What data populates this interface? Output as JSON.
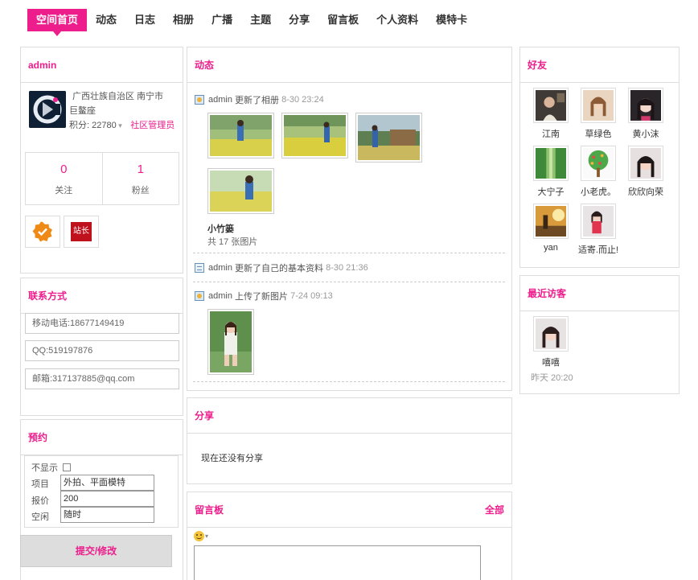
{
  "nav": {
    "tabs": [
      "空间首页",
      "动态",
      "日志",
      "相册",
      "广播",
      "主题",
      "分享",
      "留言板",
      "个人资料",
      "模特卡"
    ]
  },
  "profile": {
    "title": "admin",
    "location": "广西壮族自治区 南宁市",
    "level": "巨鳌座",
    "credit_label": "积分: 22780",
    "role": "社区管理员",
    "follow_count": "0",
    "follow_label": "关注",
    "fans_count": "1",
    "fans_label": "粉丝",
    "badge2_text": "站长"
  },
  "contact": {
    "title": "联系方式",
    "phone": "移动电话:18677149419",
    "qq": "QQ:519197876",
    "email": "邮箱:317137885@qq.com"
  },
  "booking": {
    "title": "预约",
    "hide_label": "不显示",
    "item_label": "项目",
    "item_value": "外拍、平面模特",
    "price_label": "报价",
    "price_value": "200",
    "free_label": "空闲",
    "free_value": "随时",
    "submit_label": "提交/修改"
  },
  "feed": {
    "title": "动态",
    "items": [
      {
        "user": "admin",
        "action": "更新了相册",
        "time": "8-30 23:24"
      },
      {
        "user": "admin",
        "action": "更新了自己的基本资料",
        "time": "8-30 21:36"
      },
      {
        "user": "admin",
        "action": "上传了新图片",
        "time": "7-24 09:13"
      }
    ],
    "album_name": "小竹篓",
    "album_count": "共 17 张图片"
  },
  "share": {
    "title": "分享",
    "empty_text": "现在还没有分享"
  },
  "guestbook": {
    "title": "留言板",
    "all_link": "全部"
  },
  "friends": {
    "title": "好友",
    "items": [
      {
        "name": "江南"
      },
      {
        "name": "草绿色"
      },
      {
        "name": "黄小沫"
      },
      {
        "name": "大宁子"
      },
      {
        "name": "小老虎。"
      },
      {
        "name": "欣欣向荣"
      },
      {
        "name": "yan"
      },
      {
        "name": "适寄.而止!"
      }
    ]
  },
  "visitors": {
    "title": "最近访客",
    "items": [
      {
        "name": "嘻嘻",
        "time": "昨天 20:20"
      }
    ]
  },
  "colors": {
    "accent": "#ee1d8c",
    "border": "#dddddd"
  }
}
